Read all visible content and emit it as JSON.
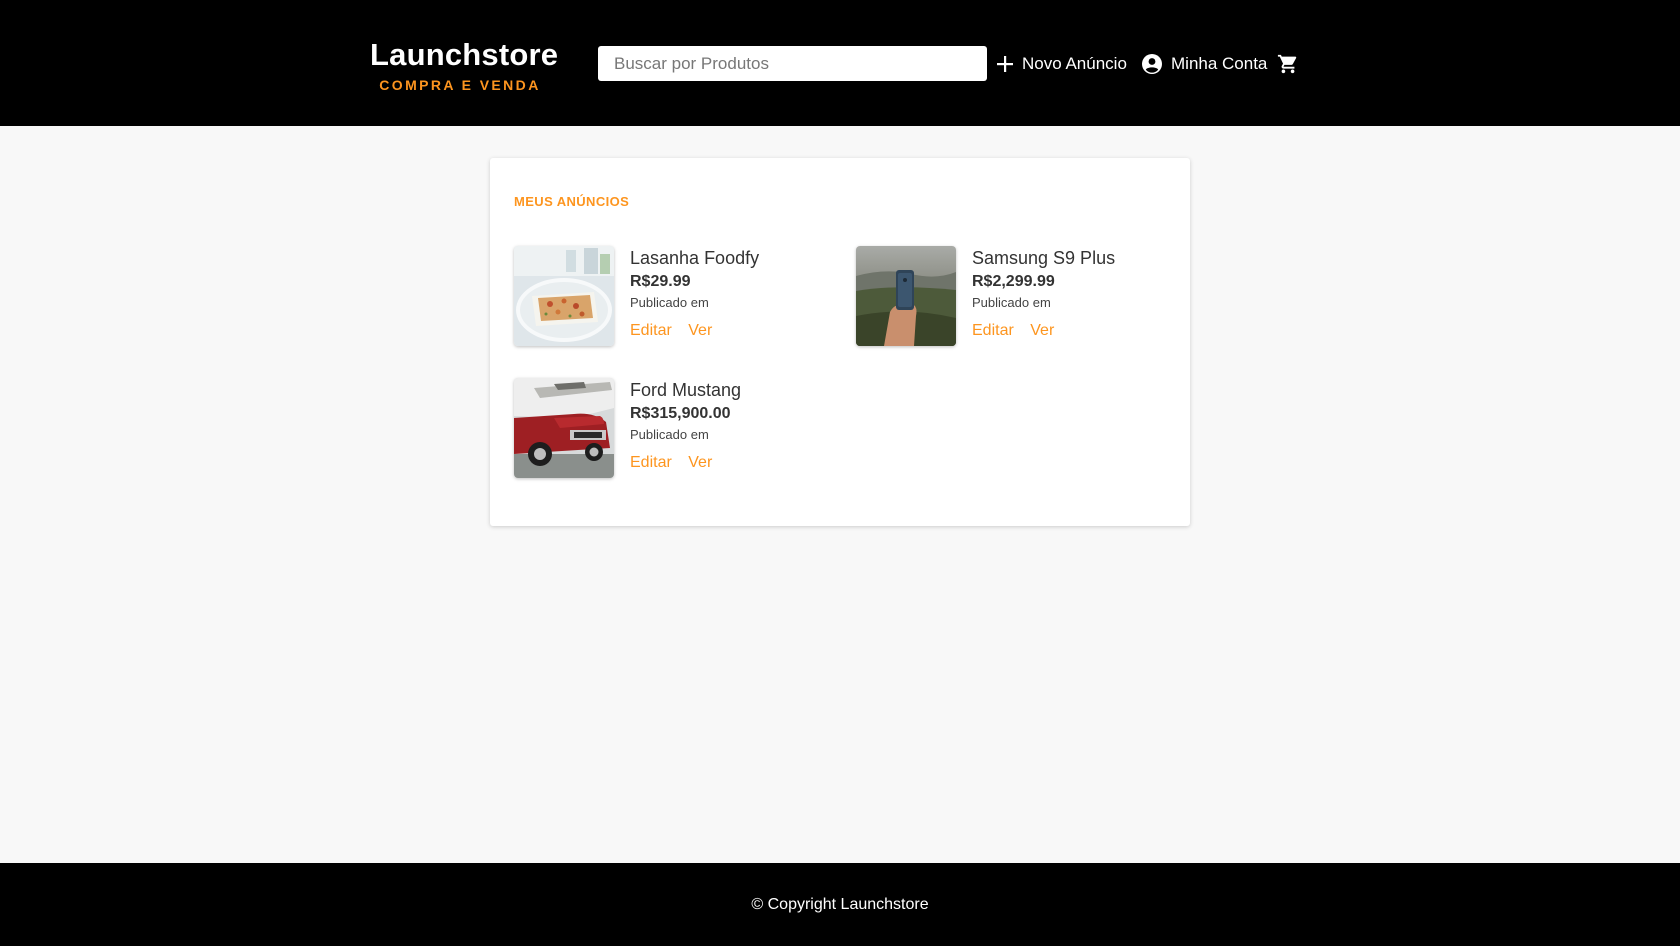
{
  "header": {
    "logo_title": "Launchstore",
    "logo_subtitle": "COMPRA E VENDA",
    "search_placeholder": "Buscar por Produtos",
    "new_ad_label": "Novo Anúncio",
    "account_label": "Minha Conta",
    "cart_icon": "cart-icon"
  },
  "main": {
    "section_title": "MEUS ANÚNCIOS",
    "items": [
      {
        "name": "Lasanha Foodfy",
        "price": "R$29.99",
        "published": "Publicado em",
        "edit_label": "Editar",
        "view_label": "Ver"
      },
      {
        "name": "Samsung S9 Plus",
        "price": "R$2,299.99",
        "published": "Publicado em",
        "edit_label": "Editar",
        "view_label": "Ver"
      },
      {
        "name": "Ford Mustang",
        "price": "R$315,900.00",
        "published": "Publicado em",
        "edit_label": "Editar",
        "view_label": "Ver"
      }
    ]
  },
  "footer": {
    "copyright": "© Copyright Launchstore"
  },
  "colors": {
    "accent": "#fd951f",
    "header_bg": "#000000",
    "page_bg": "#f8f8f8"
  }
}
